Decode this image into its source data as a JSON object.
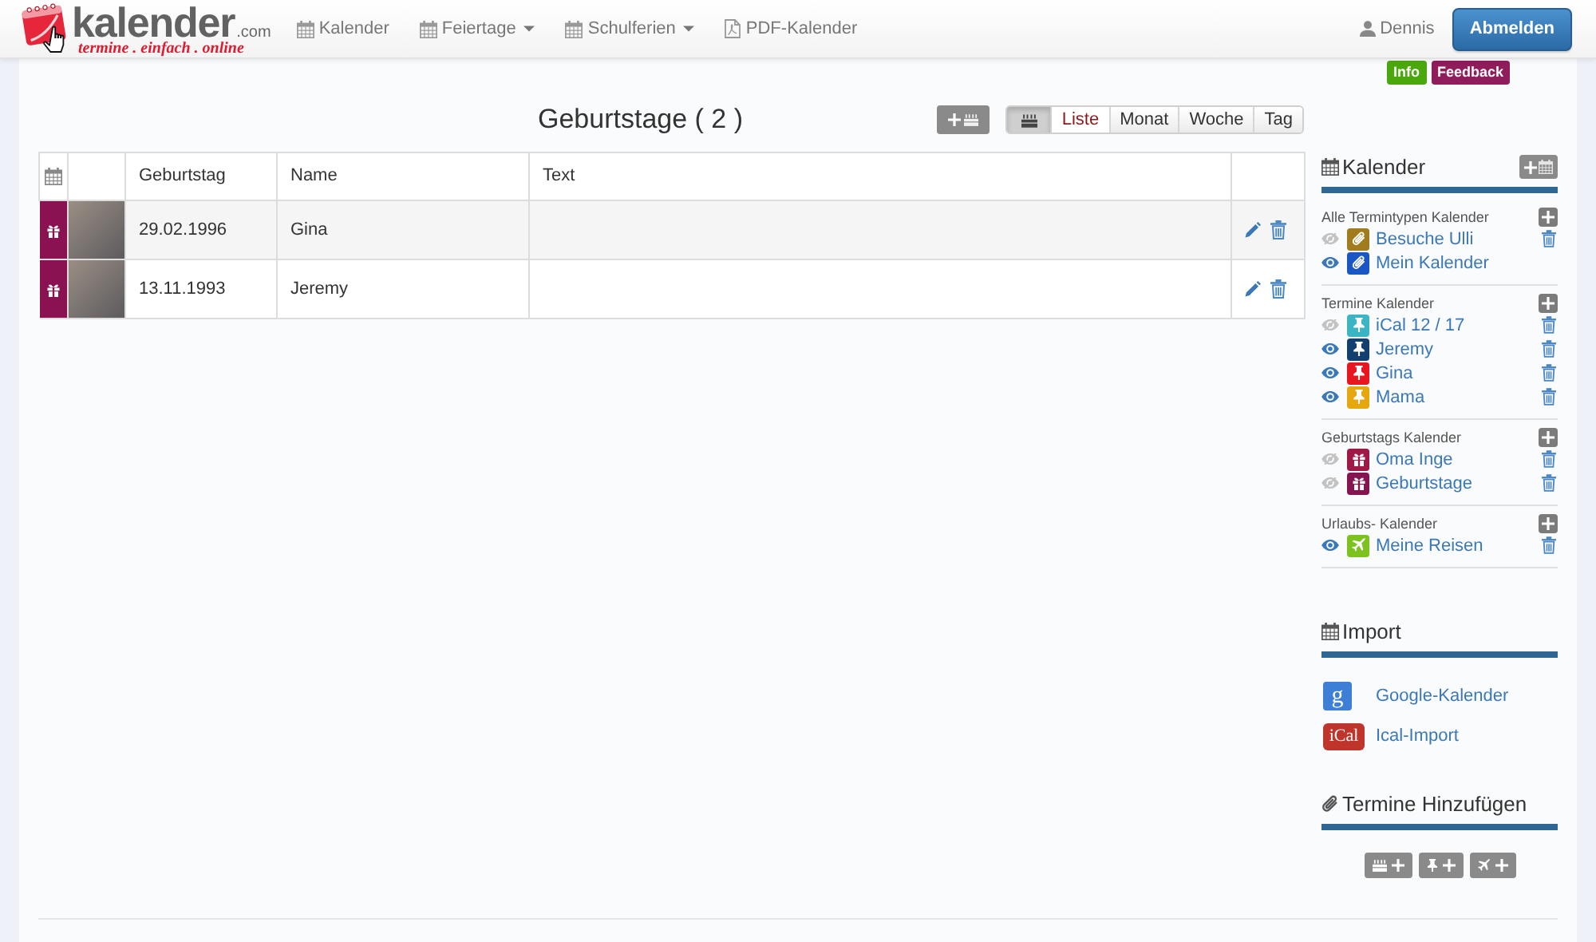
{
  "logo": {
    "wordmark": "kalender",
    "suffix": ".com",
    "tagline": "termine . einfach . online"
  },
  "nav": [
    {
      "label": "Kalender",
      "kind": "calendar",
      "dropdown": false
    },
    {
      "label": "Feiertage",
      "kind": "calendar",
      "dropdown": true
    },
    {
      "label": "Schulferien",
      "kind": "calendar",
      "dropdown": true
    },
    {
      "label": "PDF-Kalender",
      "kind": "pdf",
      "dropdown": false
    }
  ],
  "user": {
    "name": "Dennis",
    "logout": "Abmelden"
  },
  "badges": [
    {
      "label": "Info",
      "color": "#4aa80c"
    },
    {
      "label": "Feedback",
      "color": "#8f1c5b"
    }
  ],
  "page": {
    "title": "Geburtstage ( 2 )",
    "filter": {
      "pressed": true
    },
    "views": [
      {
        "label": "Liste",
        "selected": true
      },
      {
        "label": "Monat",
        "selected": false
      },
      {
        "label": "Woche",
        "selected": false
      },
      {
        "label": "Tag",
        "selected": false
      }
    ]
  },
  "table": {
    "columns": [
      "Geburtstag",
      "Name",
      "Text"
    ],
    "rows": [
      {
        "date": "29.02.1996",
        "name": "Gina",
        "color": "#8b1252"
      },
      {
        "date": "13.11.1993",
        "name": "Jeremy",
        "color": "#8b1252"
      }
    ]
  },
  "sidebar": {
    "calendars": {
      "title": "Kalender",
      "groups": [
        {
          "title": "Alle Termintypen Kalender",
          "kind": "general",
          "items": [
            {
              "label": "Besuche Ulli",
              "visible": false,
              "color": "#a07c1e",
              "deletable": true
            },
            {
              "label": "Mein Kalender",
              "visible": true,
              "color": "#1a56c4",
              "deletable": false
            }
          ]
        },
        {
          "title": "Termine Kalender",
          "kind": "appointment",
          "items": [
            {
              "label": "iCal 12 / 17",
              "visible": false,
              "color": "#3bb5c3",
              "deletable": true
            },
            {
              "label": "Jeremy",
              "visible": true,
              "color": "#123f6e",
              "deletable": true
            },
            {
              "label": "Gina",
              "visible": true,
              "color": "#e8161e",
              "deletable": true
            },
            {
              "label": "Mama",
              "visible": true,
              "color": "#e6a70e",
              "deletable": true
            }
          ]
        },
        {
          "title": "Geburtstags Kalender",
          "kind": "birthday",
          "items": [
            {
              "label": "Oma Inge",
              "visible": false,
              "color": "#a01845",
              "deletable": true
            },
            {
              "label": "Geburtstage",
              "visible": false,
              "color": "#861450",
              "deletable": true
            }
          ]
        },
        {
          "title": "Urlaubs- Kalender",
          "kind": "vacation",
          "items": [
            {
              "label": "Meine Reisen",
              "visible": true,
              "color": "#7dc31f",
              "deletable": true
            }
          ]
        }
      ]
    },
    "import": {
      "title": "Import",
      "items": [
        {
          "kind": "google",
          "badge": "g",
          "label": "Google-Kalender"
        },
        {
          "kind": "ical",
          "badge": "iCal",
          "label": "Ical-Import"
        }
      ]
    },
    "add_entries": {
      "title": "Termine Hinzufügen",
      "buttons": [
        {
          "kind": "birthday"
        },
        {
          "kind": "appointment"
        },
        {
          "kind": "vacation"
        }
      ]
    }
  }
}
